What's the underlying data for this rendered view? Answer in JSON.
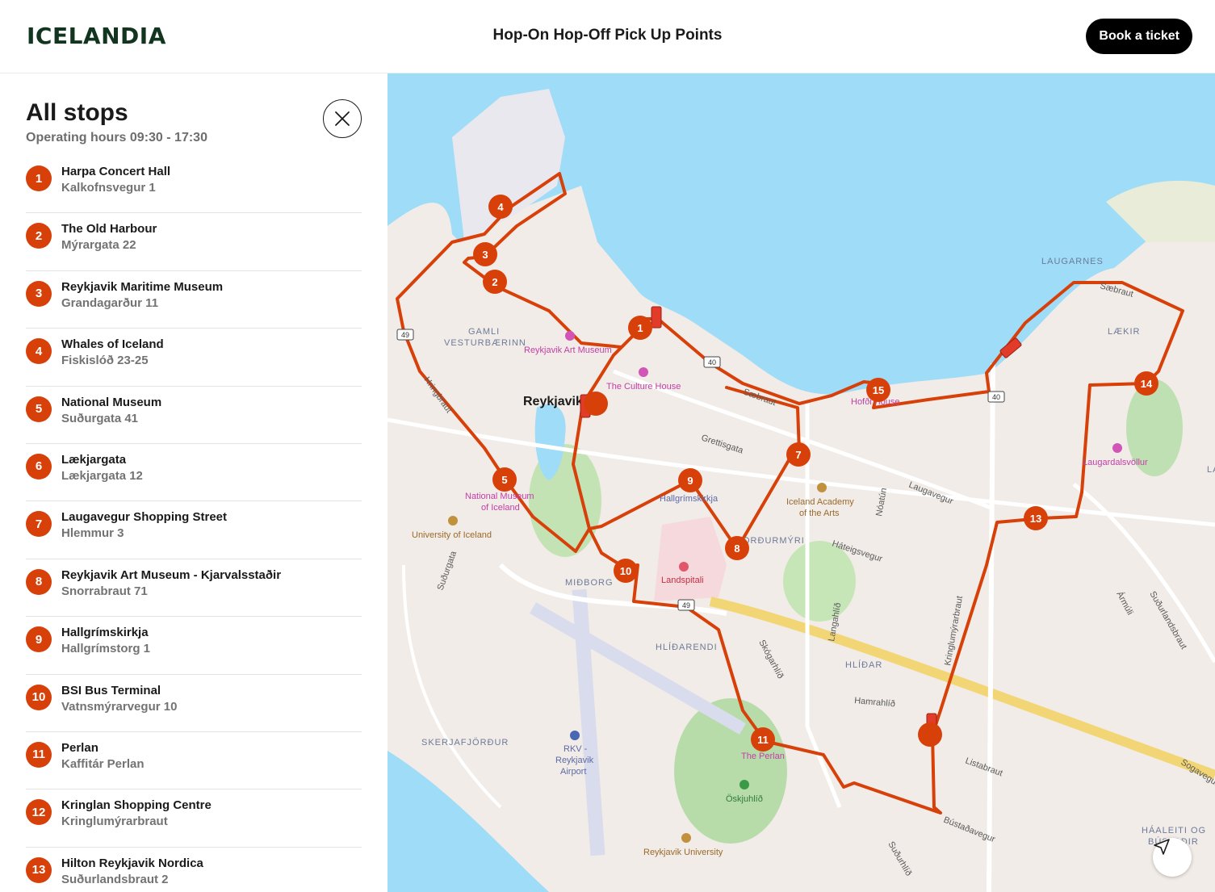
{
  "header": {
    "logo": "ICELANDIA",
    "title": "Hop-On Hop-Off Pick Up Points",
    "book_label": "Book a ticket"
  },
  "panel": {
    "title": "All stops",
    "hours": "Operating hours 09:30 - 17:30",
    "stops": [
      {
        "num": "1",
        "name": "Harpa Concert Hall",
        "address": "Kalkofnsvegur 1"
      },
      {
        "num": "2",
        "name": "The Old Harbour",
        "address": "Mýrargata 22"
      },
      {
        "num": "3",
        "name": "Reykjavik Maritime Museum",
        "address": "Grandagarður 11"
      },
      {
        "num": "4",
        "name": "Whales of Iceland",
        "address": "Fiskislóð 23-25"
      },
      {
        "num": "5",
        "name": "National Museum",
        "address": "Suðurgata 41"
      },
      {
        "num": "6",
        "name": "Lækjargata",
        "address": "Lækjargata 12"
      },
      {
        "num": "7",
        "name": "Laugavegur Shopping Street",
        "address": "Hlemmur 3"
      },
      {
        "num": "8",
        "name": "Reykjavik Art Museum - Kjarvalsstaðir",
        "address": "Snorrabraut 71"
      },
      {
        "num": "9",
        "name": "Hallgrímskirkja",
        "address": "Hallgrímstorg 1"
      },
      {
        "num": "10",
        "name": "BSI Bus Terminal",
        "address": "Vatnsmýrarvegur 10"
      },
      {
        "num": "11",
        "name": "Perlan",
        "address": "Kaffitár Perlan"
      },
      {
        "num": "12",
        "name": "Kringlan Shopping Centre",
        "address": "Kringlumýrarbraut"
      },
      {
        "num": "13",
        "name": "Hilton Reykjavik Nordica",
        "address": "Suðurlandsbraut 2"
      }
    ]
  },
  "map": {
    "city_label": "Reykjavik",
    "route_color": "#d8400a",
    "labels": {
      "laugarnes": "LAUGARNES",
      "laekir": "LÆKIR",
      "laug": "LAUG",
      "gamli": "GAMLI",
      "vesturbaerinn": "VESTURBÆRINN",
      "midborg": "MIÐBORG",
      "hlidarendi": "HLÍÐARENDI",
      "hlidar": "HLÍÐAR",
      "skerjafjordur": "SKERJAFJÖRÐUR",
      "nordurmyri": "ORÐURMÝRI",
      "haaleiti": "HÁALEITI OG",
      "bustadir": "BÚSTAÐIR",
      "art_museum": "Reykjavik Art Museum",
      "culture_house": "The Culture House",
      "national_museum_1": "National Museum",
      "national_museum_2": "of Iceland",
      "university": "University of Iceland",
      "hallgrimskirkja": "Hallgrímskirkja",
      "landspitali": "Landspitali",
      "academy_1": "Iceland Academy",
      "academy_2": "of the Arts",
      "hofdi": "Hofði House",
      "laugardalsvollur": "Laugardalsvöllur",
      "perlan": "The Perlan",
      "oskjuhlid": "Öskjuhlíð",
      "ru": "Reykjavik University",
      "rkv_1": "RKV -",
      "rkv_2": "Reykjavik",
      "rkv_3": "Airport",
      "grettisgata": "Grettisgata",
      "laugavegur": "Laugavegur",
      "noatun": "Nóatún",
      "hateigsvegur": "Háteigsvegur",
      "saebraut": "Sæbraut",
      "saebraut2": "Sæbraut",
      "hringbraut": "Hringbraut",
      "sudurgata": "Suðurgata",
      "langahlid": "Langahlíð",
      "skogarhlid": "Skógarhlíð",
      "hamrahlid": "Hamrahlíð",
      "kringlumyrarbraut": "Kringlumýrarbraut",
      "listabraut": "Listabraut",
      "bustadavegur": "Bústaðavegur",
      "sudurhlid": "Suðurhlíð",
      "armuli": "Ármúli",
      "sudurlandsbraut": "Suðurlandsbraut",
      "sogavegur": "Sogavegur",
      "shield_49": "49",
      "shield_49b": "49",
      "shield_40": "40",
      "shield_40b": "40"
    }
  }
}
